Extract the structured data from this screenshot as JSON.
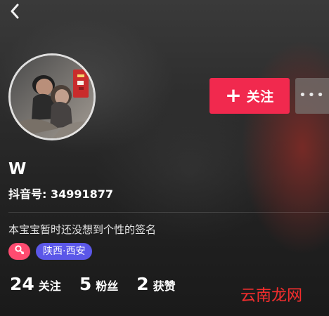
{
  "nav": {
    "back_icon": "chevron-left-icon"
  },
  "profile": {
    "avatar_icon": "avatar-photo-icon",
    "name": "W",
    "account_id": "抖音号: 34991877",
    "signature": "本宝宝暂时还没想到个性的签名",
    "gender_icon": "female-symbol-icon",
    "location": "陕西·西安"
  },
  "actions": {
    "follow_icon": "plus-icon",
    "follow_label": "关注",
    "more_icon": "more-dots-icon",
    "more_label": "•••"
  },
  "stats": [
    {
      "value": "24",
      "label": "关注"
    },
    {
      "value": "5",
      "label": "粉丝"
    },
    {
      "value": "2",
      "label": "获赞"
    }
  ],
  "watermark": {
    "text": "云南龙网"
  },
  "colors": {
    "follow_button": "#f1294e",
    "gender_badge": "#ff4b70",
    "location_badge": "#5b57e8",
    "watermark": "#f42b2b"
  }
}
